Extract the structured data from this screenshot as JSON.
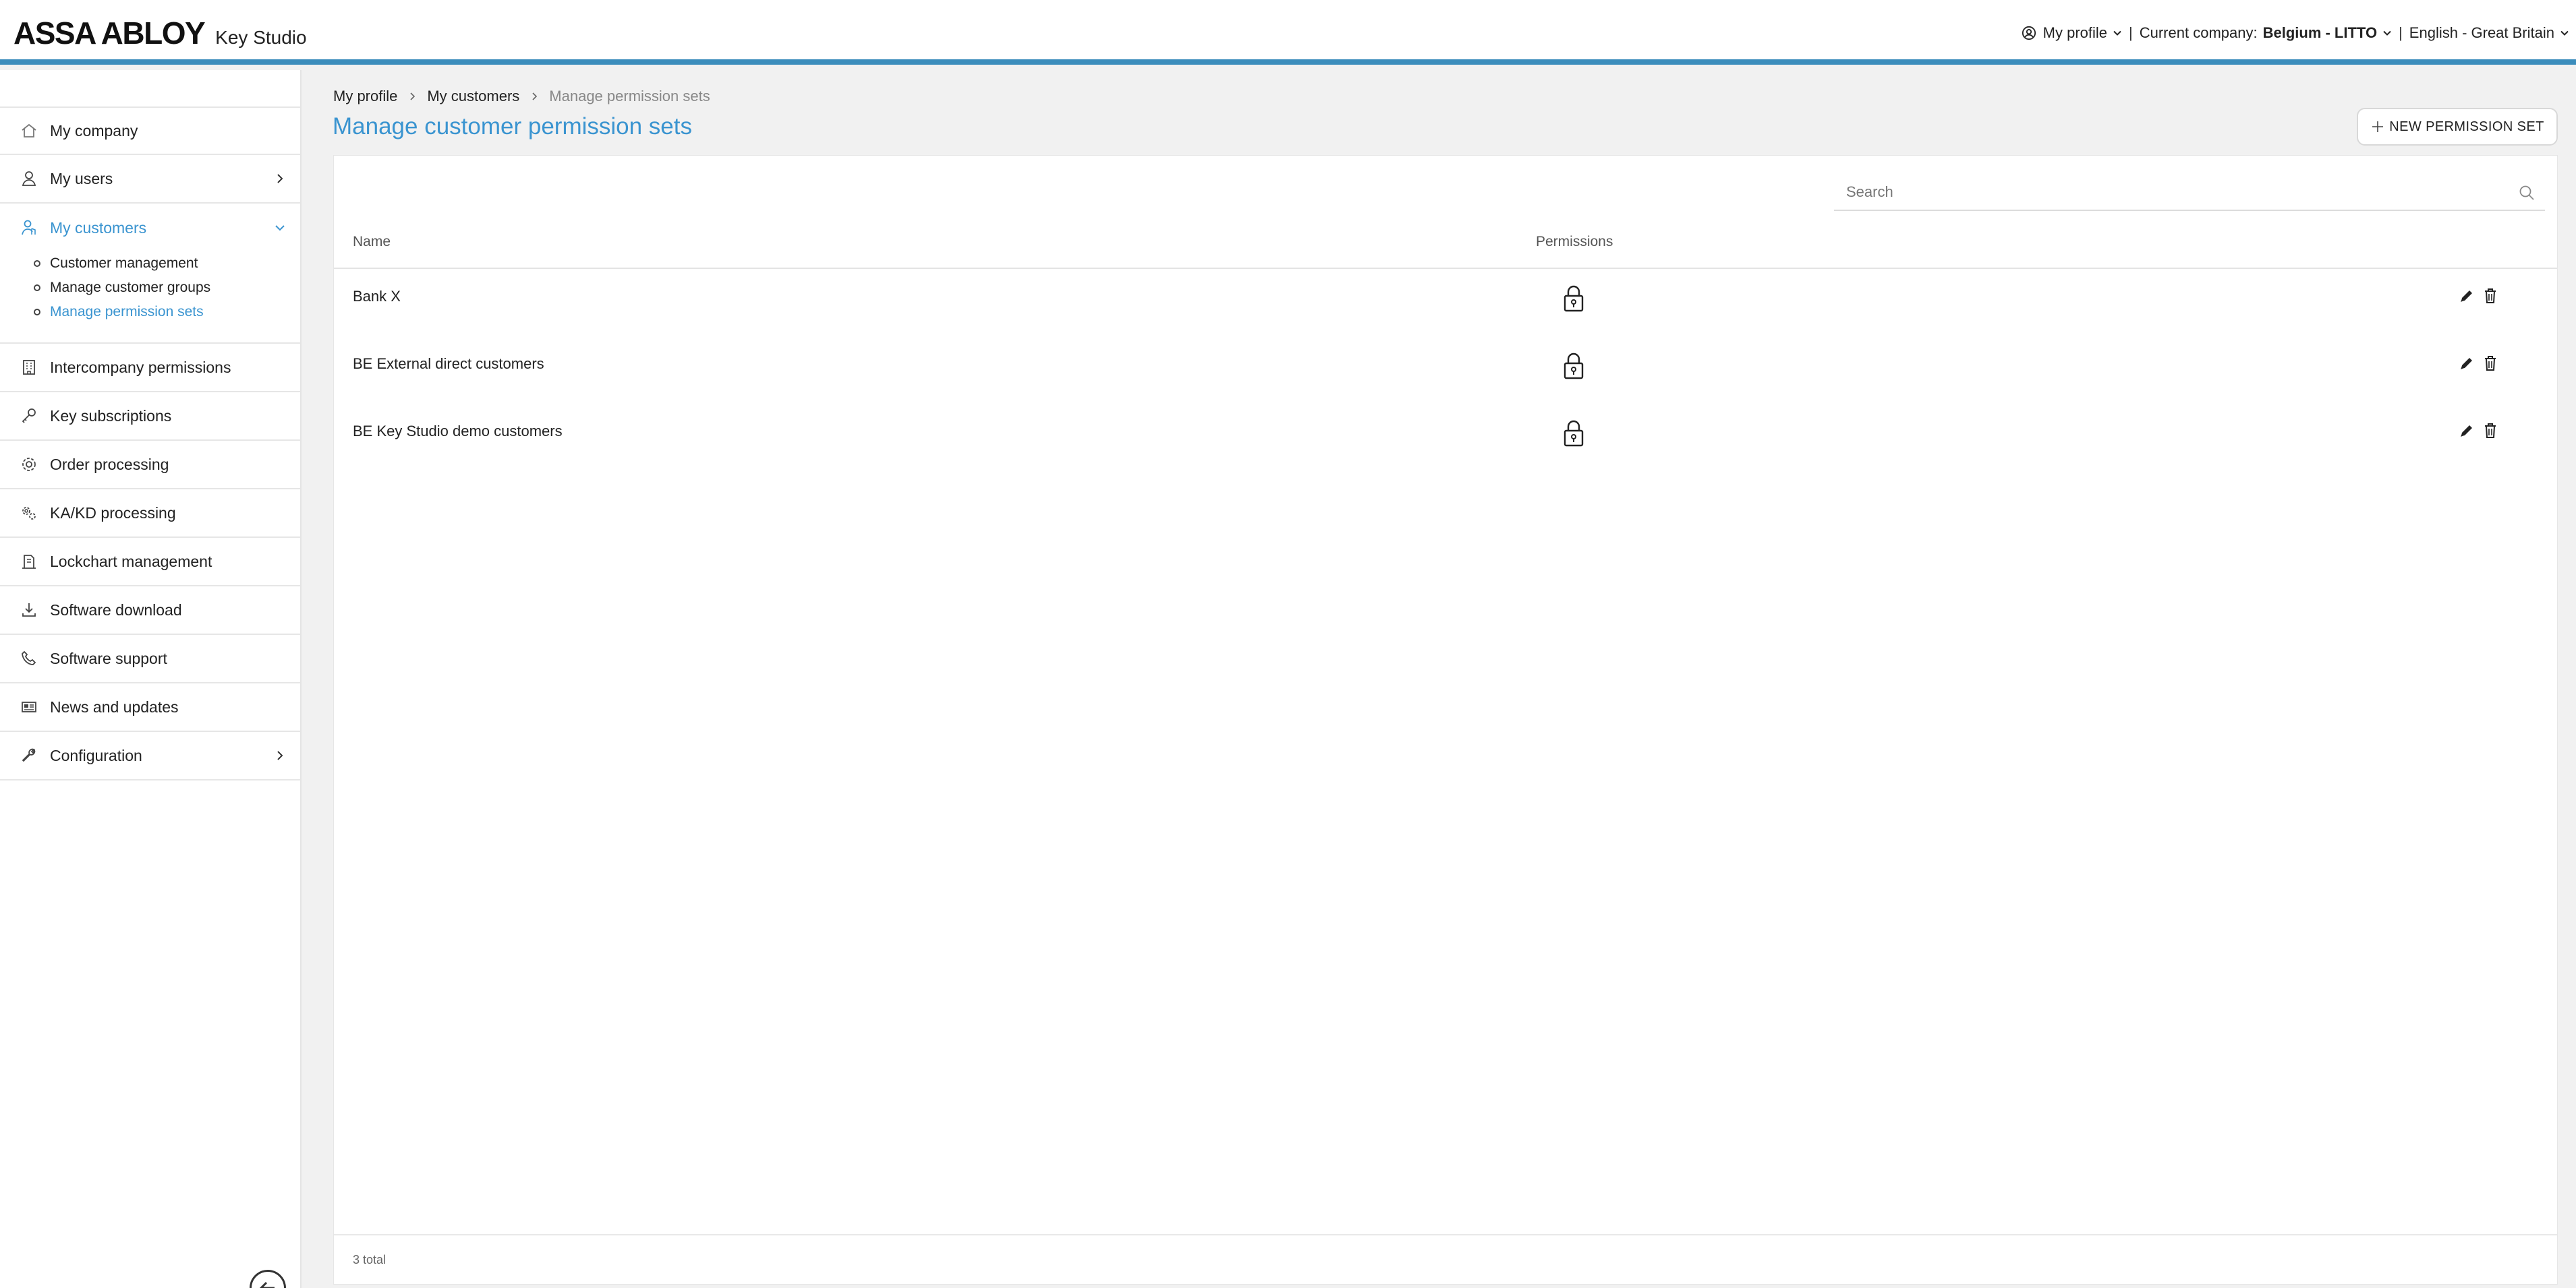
{
  "header": {
    "brand": "ASSA ABLOY",
    "product": "Key Studio",
    "profile_label": "My profile",
    "company_prefix": "Current company:",
    "company_name": "Belgium - LITTO",
    "language": "English - Great Britain",
    "accent_color": "#3c8dbc"
  },
  "sidebar": {
    "items": [
      {
        "label": "My company",
        "icon": "home-icon"
      },
      {
        "label": "My users",
        "icon": "user-icon"
      },
      {
        "label": "My customers",
        "icon": "customers-icon"
      },
      {
        "label": "Intercompany permissions",
        "icon": "building-icon"
      },
      {
        "label": "Key subscriptions",
        "icon": "key-icon"
      },
      {
        "label": "Order processing",
        "icon": "gear-icon"
      },
      {
        "label": "KA/KD processing",
        "icon": "gears-icon"
      },
      {
        "label": "Lockchart management",
        "icon": "lockchart-icon"
      },
      {
        "label": "Software download",
        "icon": "download-icon"
      },
      {
        "label": "Software support",
        "icon": "phone-icon"
      },
      {
        "label": "News and updates",
        "icon": "news-icon"
      },
      {
        "label": "Configuration",
        "icon": "wrench-icon"
      }
    ],
    "subitems": [
      {
        "label": "Customer management"
      },
      {
        "label": "Manage customer groups"
      },
      {
        "label": "Manage permission sets"
      }
    ]
  },
  "breadcrumb": {
    "items": [
      "My profile",
      "My customers",
      "Manage permission sets"
    ]
  },
  "page": {
    "title": "Manage customer permission sets",
    "new_button": "NEW PERMISSION SET"
  },
  "search": {
    "placeholder": "Search"
  },
  "table": {
    "columns": [
      "Name",
      "Permissions"
    ],
    "rows": [
      {
        "name": "Bank X"
      },
      {
        "name": "BE External direct customers"
      },
      {
        "name": "BE Key Studio demo customers"
      }
    ],
    "total": "3 total"
  }
}
